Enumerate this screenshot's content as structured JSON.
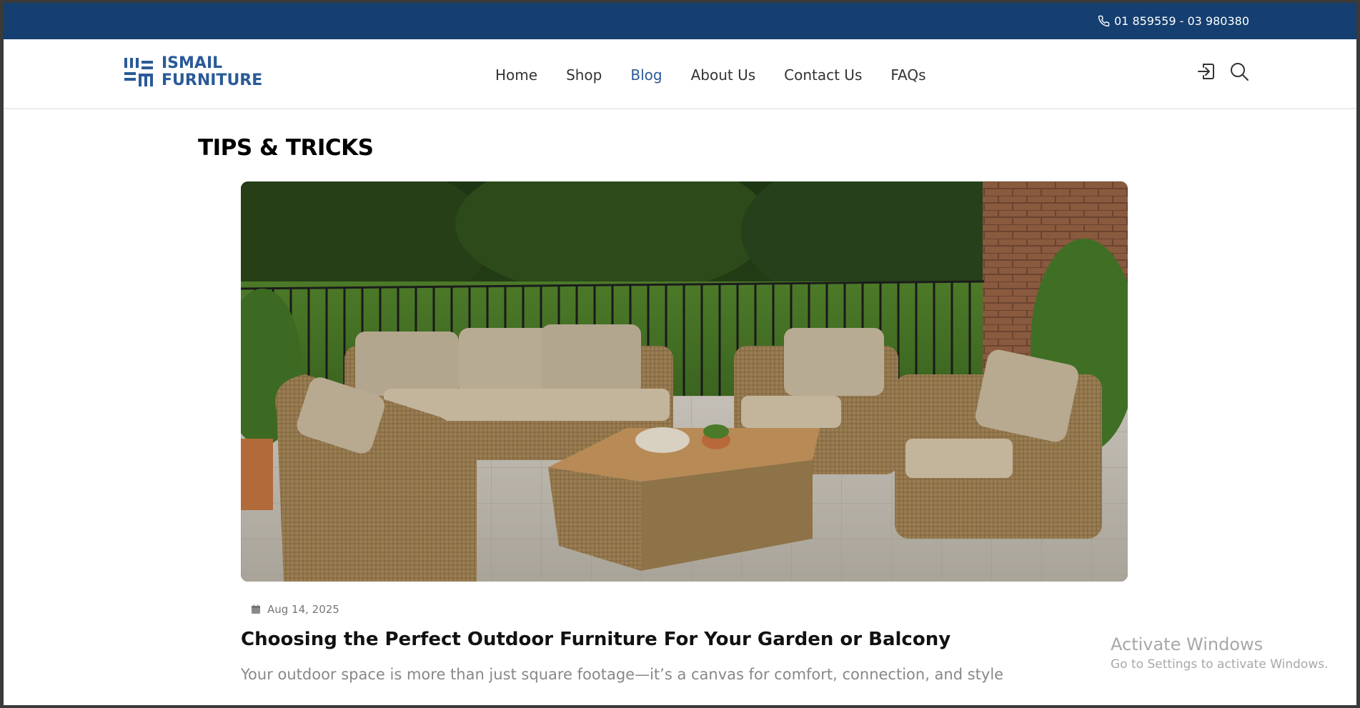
{
  "topbar": {
    "phone": "01 859559 - 03 980380",
    "phone_icon": "phone-icon",
    "bg_color": "#143f70"
  },
  "header": {
    "logo_line1": "ISMAIL",
    "logo_line2": "FURNITURE",
    "brand_color": "#2a5a97",
    "nav": [
      {
        "label": "Home"
      },
      {
        "label": "Shop"
      },
      {
        "label": "Blog"
      },
      {
        "label": "About Us"
      },
      {
        "label": "Contact Us"
      },
      {
        "label": "FAQs"
      }
    ],
    "active_nav": "Blog",
    "icons": [
      "login-icon",
      "search-icon"
    ]
  },
  "main": {
    "section_title": "TIPS & TRICKS",
    "post": {
      "date": "Aug 14, 2025",
      "date_icon": "calendar-icon",
      "title": "Choosing the Perfect Outdoor Furniture For Your Garden or Balcony",
      "excerpt": "Your outdoor space is more than just square footage—it’s a canvas for comfort, connection, and style"
    }
  },
  "watermark": {
    "line1": "Activate Windows",
    "line2": "Go to Settings to activate Windows."
  }
}
